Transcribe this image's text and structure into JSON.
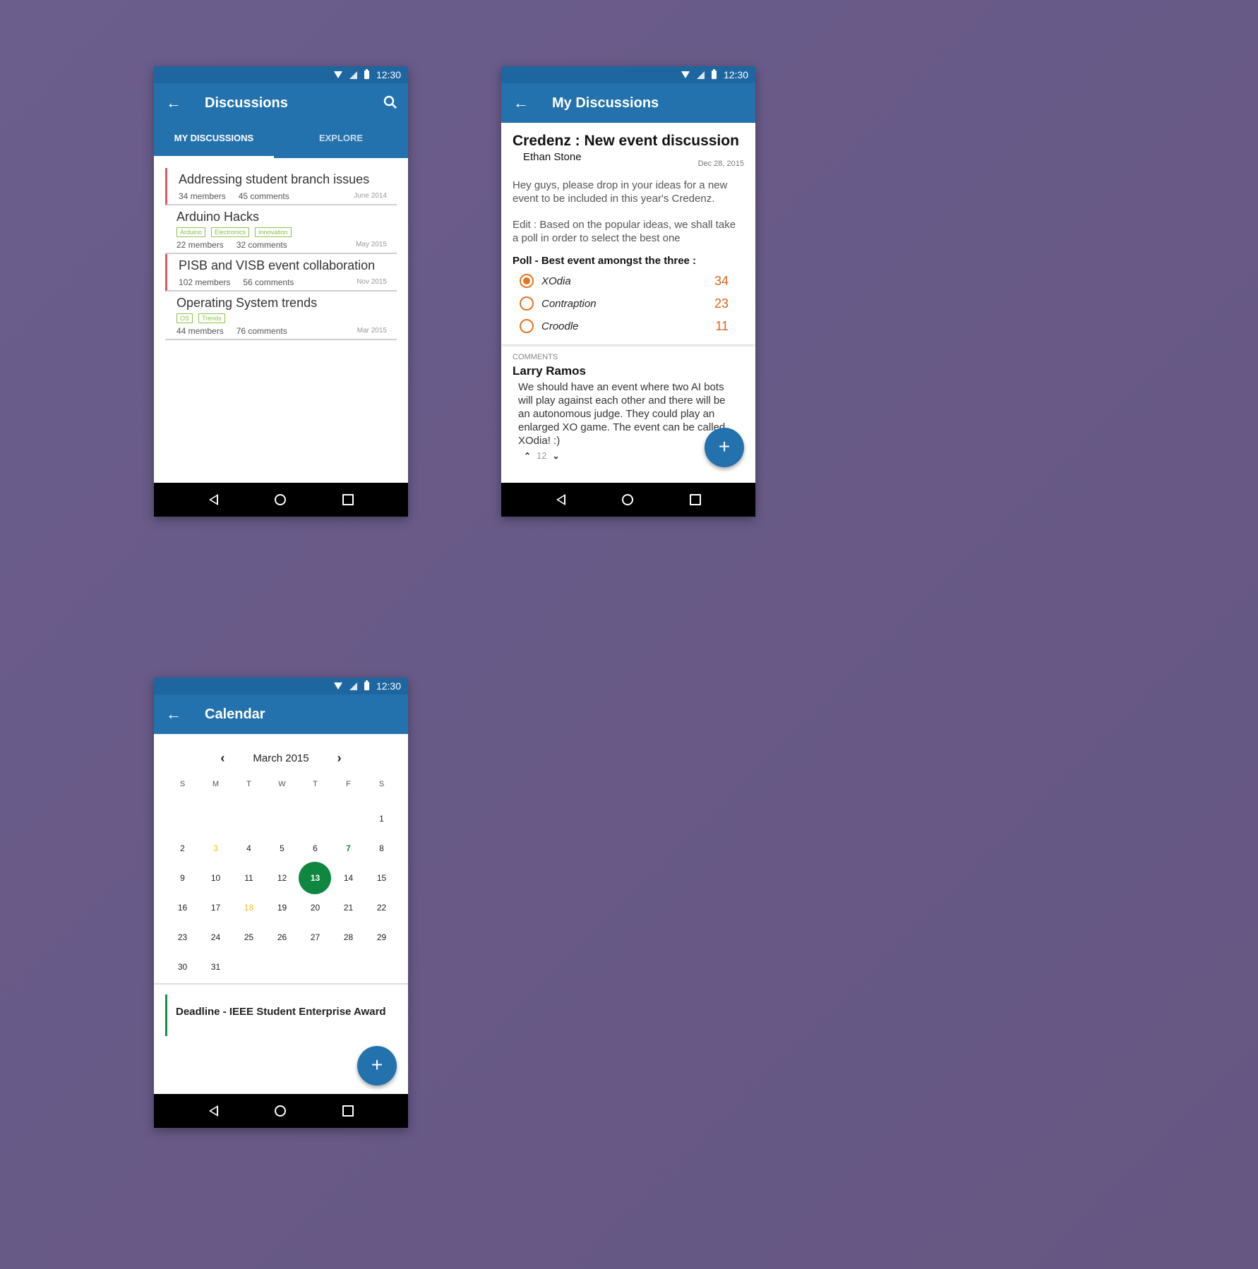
{
  "status": {
    "time": "12:30"
  },
  "discussions": {
    "title": "Discussions",
    "tabs": [
      "MY DISCUSSIONS",
      "EXPLORE"
    ],
    "items": [
      {
        "title": "Addressing student branch issues",
        "members": "34 members",
        "comments": "45 comments",
        "date": "June 2014",
        "flag": true,
        "tags": []
      },
      {
        "title": "Arduino Hacks",
        "members": "22 members",
        "comments": "32 comments",
        "date": "May 2015",
        "flag": false,
        "tags": [
          "Arduino",
          "Electronics",
          "Innovation"
        ]
      },
      {
        "title": "PISB and VISB event collaboration",
        "members": "102 members",
        "comments": "56 comments",
        "date": "Nov 2015",
        "flag": true,
        "tags": []
      },
      {
        "title": "Operating System trends",
        "members": "44 members",
        "comments": "76 comments",
        "date": "Mar 2015",
        "flag": false,
        "tags": [
          "OS",
          "Trends"
        ]
      }
    ]
  },
  "my_discussions": {
    "title": "My Discussions",
    "post_title": "Credenz : New event discussion",
    "author": "Ethan Stone",
    "date": "Dec 28, 2015",
    "body1": "Hey guys, please drop in your ideas for a new event to be included in this year's Credenz.",
    "body2": "Edit : Based on the popular ideas, we shall take a poll in order to select the best one",
    "poll_question": "Poll - Best event amongst the three :",
    "options": [
      {
        "label": "XOdia",
        "count": "34",
        "selected": true
      },
      {
        "label": "Contraption",
        "count": "23",
        "selected": false
      },
      {
        "label": "Croodle",
        "count": "11",
        "selected": false
      }
    ],
    "comments_label": "COMMENTS",
    "comment_author": "Larry Ramos",
    "comment_text": "We should have an event where two AI bots will play against each other and there will be an autonomous judge. They could play an enlarged XO game. The event can be called XOdia! :)",
    "votes": "12"
  },
  "calendar": {
    "title": "Calendar",
    "month": "March 2015",
    "weekdays": [
      "S",
      "M",
      "T",
      "W",
      "T",
      "F",
      "S"
    ],
    "days": [
      "",
      "",
      "",
      "",
      "",
      "",
      "1",
      "2",
      "3",
      "4",
      "5",
      "6",
      "7",
      "8",
      "9",
      "10",
      "11",
      "12",
      "13",
      "14",
      "15",
      "16",
      "17",
      "18",
      "19",
      "20",
      "21",
      "22",
      "23",
      "24",
      "25",
      "26",
      "27",
      "28",
      "29",
      "30",
      "31",
      "",
      "",
      "",
      "",
      ""
    ],
    "highlight_yellow": [
      "3",
      "18"
    ],
    "highlight_green": [
      "7"
    ],
    "selected": "13",
    "event": "Deadline - IEEE Student Enterprise Award"
  },
  "colors": {
    "primary": "#2372ad",
    "accent_orange": "#e47424",
    "green": "#0f8740",
    "yellow": "#f0c020",
    "flag_red": "#e05868",
    "tag_green": "#8bc34a"
  },
  "icons": {
    "back": "arrow-left-icon",
    "search": "search-icon",
    "add": "plus-icon"
  }
}
